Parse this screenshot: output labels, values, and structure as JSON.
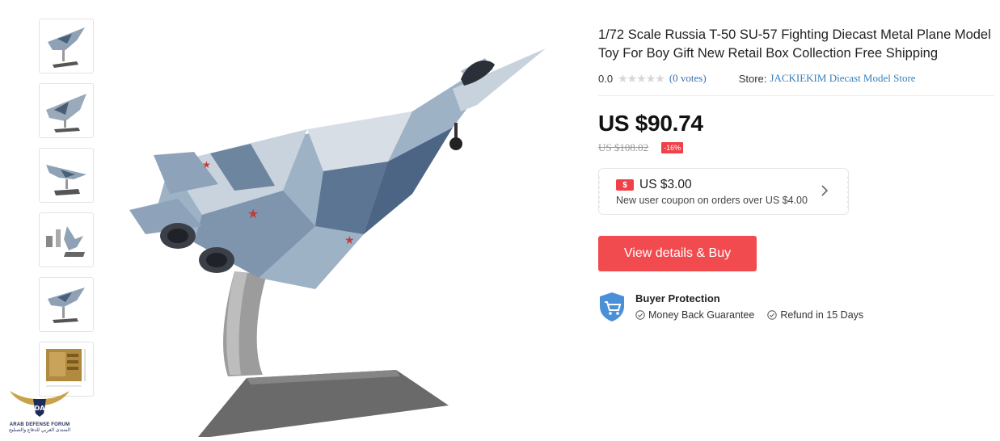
{
  "product": {
    "title": "1/72 Scale Russia T-50 SU-57 Fighting Diecast Metal Plane Model Toy For Boy Gift New Retail Box Collection Free Shipping",
    "rating_value": "0.0",
    "stars": "★★★★★",
    "votes": "(0 votes)",
    "store_label": "Store:",
    "store_name": "JACKIEKIM Diecast Model Store",
    "price": "US $90.74",
    "original_price": "US $108.02",
    "discount": "-16%"
  },
  "coupon": {
    "icon_text": "$",
    "amount": "US $3.00",
    "description": "New user coupon on orders over US $4.00"
  },
  "buy_button": {
    "label": "View details & Buy"
  },
  "protection": {
    "title": "Buyer Protection",
    "items": [
      "Money Back Guarantee",
      "Refund in 15 Days"
    ]
  },
  "watermark": {
    "badge": "DA",
    "line1": "ARAB DEFENSE FORUM",
    "line2": "المنتدى العربي للدفاع والتسليح"
  },
  "colors": {
    "accent_red": "#f24b4f",
    "link_blue": "#3a7fb8",
    "shield_blue": "#4a90d9"
  },
  "icons": {
    "thumbnail_count": 6,
    "coupon": "dollar-tag-icon",
    "chevron": "chevron-right-icon",
    "shield": "shield-cart-icon",
    "check": "check-circle-icon"
  }
}
